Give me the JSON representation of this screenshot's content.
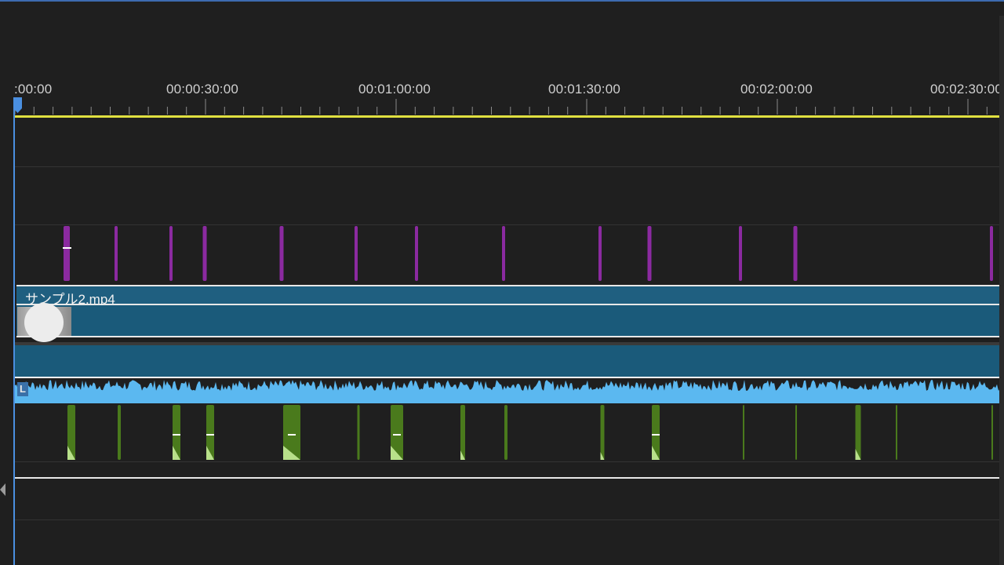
{
  "timeline": {
    "ruler_labels": [
      ":00:00",
      "00:00:30:00",
      "00:01:00:00",
      "00:01:30:00",
      "00:02:00:00",
      "00:02:30:00"
    ],
    "clips": {
      "video_clip_name": "サンプル2.mp4",
      "audio_channel_label": "L"
    }
  },
  "colors": {
    "work_area_bar": "#e0e040",
    "playhead": "#4a8fe0",
    "clip_fill": "#1a5a7a",
    "waveform": "#5bb8f0",
    "marker_purple": "#8b2aa0",
    "marker_green": "#4a7a1c"
  },
  "icons": {
    "playhead_handle": "playhead-icon",
    "collapse_arrow": "triangle-left-icon"
  }
}
